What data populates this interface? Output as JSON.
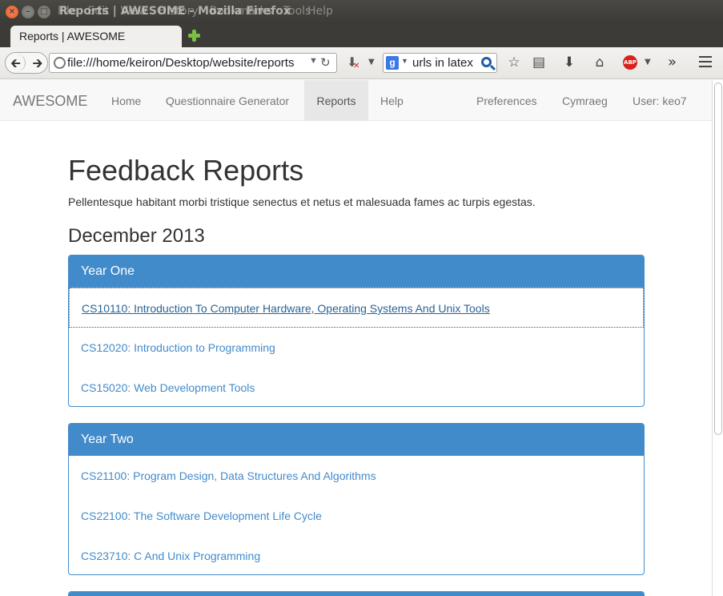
{
  "window": {
    "title": "Reports | AWESOME - Mozilla Firefox",
    "menu_ghost": [
      "File",
      "Edit",
      "View",
      "History",
      "Bookmarks",
      "Tools"
    ],
    "menu_help": "Help"
  },
  "tab": {
    "label": "Reports | AWESOME"
  },
  "toolbar": {
    "url": "file:///home/keiron/Desktop/website/reports",
    "search_query": "urls in latex"
  },
  "site": {
    "brand": "AWESOME",
    "nav": [
      "Home",
      "Questionnaire Generator",
      "Reports",
      "Help"
    ],
    "nav_active": "Reports",
    "nav_right": [
      "Preferences",
      "Cymraeg",
      "User: keo7"
    ]
  },
  "page": {
    "title": "Feedback Reports",
    "lead": "Pellentesque habitant morbi tristique senectus et netus et malesuada fames ac turpis egestas.",
    "section": "December 2013",
    "panels": [
      {
        "heading": "Year One",
        "items": [
          "CS10110: Introduction To Computer Hardware, Operating Systems And Unix Tools",
          "CS12020: Introduction to Programming",
          "CS15020: Web Development Tools"
        ]
      },
      {
        "heading": "Year Two",
        "items": [
          "CS21100: Program Design, Data Structures And Algorithms",
          "CS22100: The Software Development Life Cycle",
          "CS23710: C And Unix Programming"
        ]
      }
    ]
  },
  "colors": {
    "primary": "#428bca",
    "link": "#428bca",
    "navbar_bg": "#f8f8f8",
    "window_titlebar": "#3c3b37"
  }
}
